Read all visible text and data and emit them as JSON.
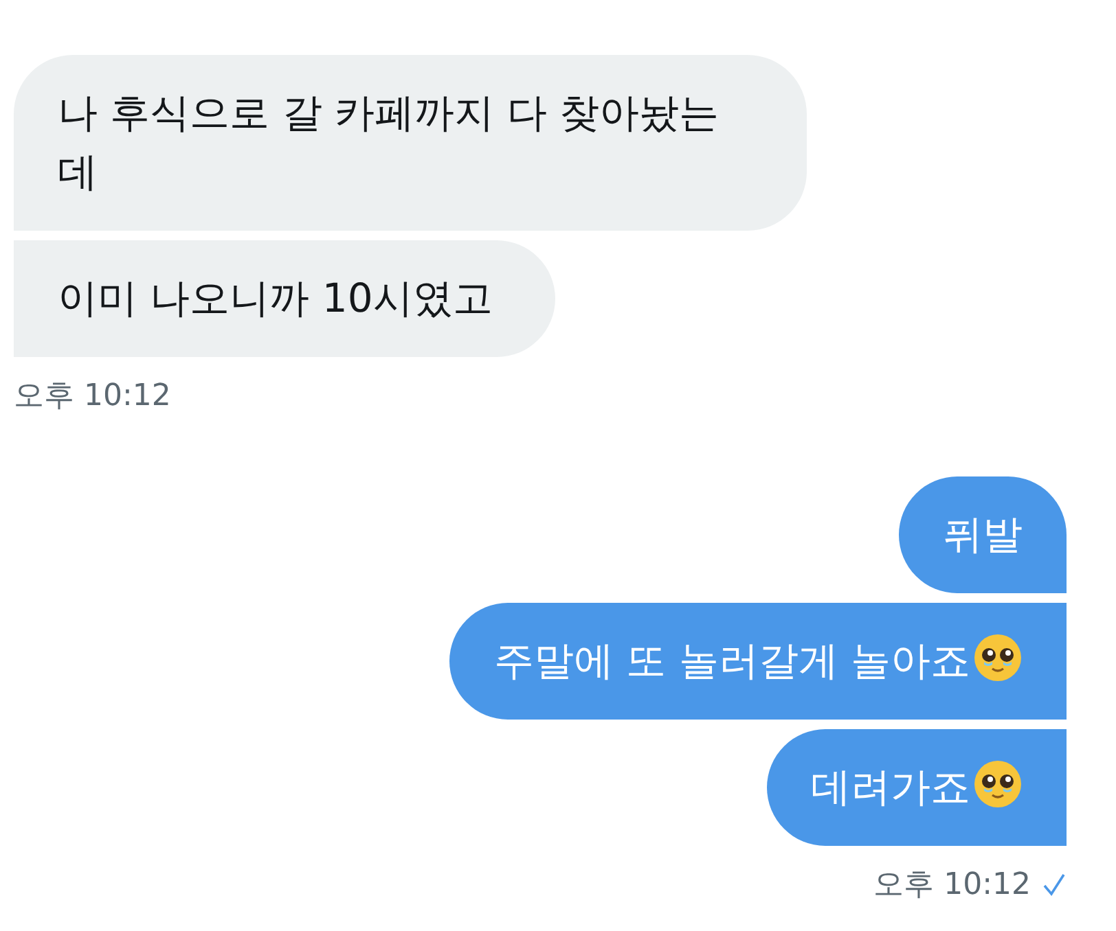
{
  "groups": [
    {
      "kind": "received",
      "messages": [
        {
          "text": "나 후식으로 갈 카페까지 다 찾아놨는데",
          "emoji": false
        },
        {
          "text": "이미 나오니까 10시였고",
          "emoji": false
        }
      ],
      "time": "오후 10:12",
      "read": false
    },
    {
      "kind": "sent",
      "messages": [
        {
          "text": "퓌발",
          "emoji": false
        },
        {
          "text": "주말에 또 놀러갈게 놀아죠",
          "emoji": true
        },
        {
          "text": "데려가죠",
          "emoji": true
        }
      ],
      "time": "오후 10:12",
      "read": true
    }
  ]
}
